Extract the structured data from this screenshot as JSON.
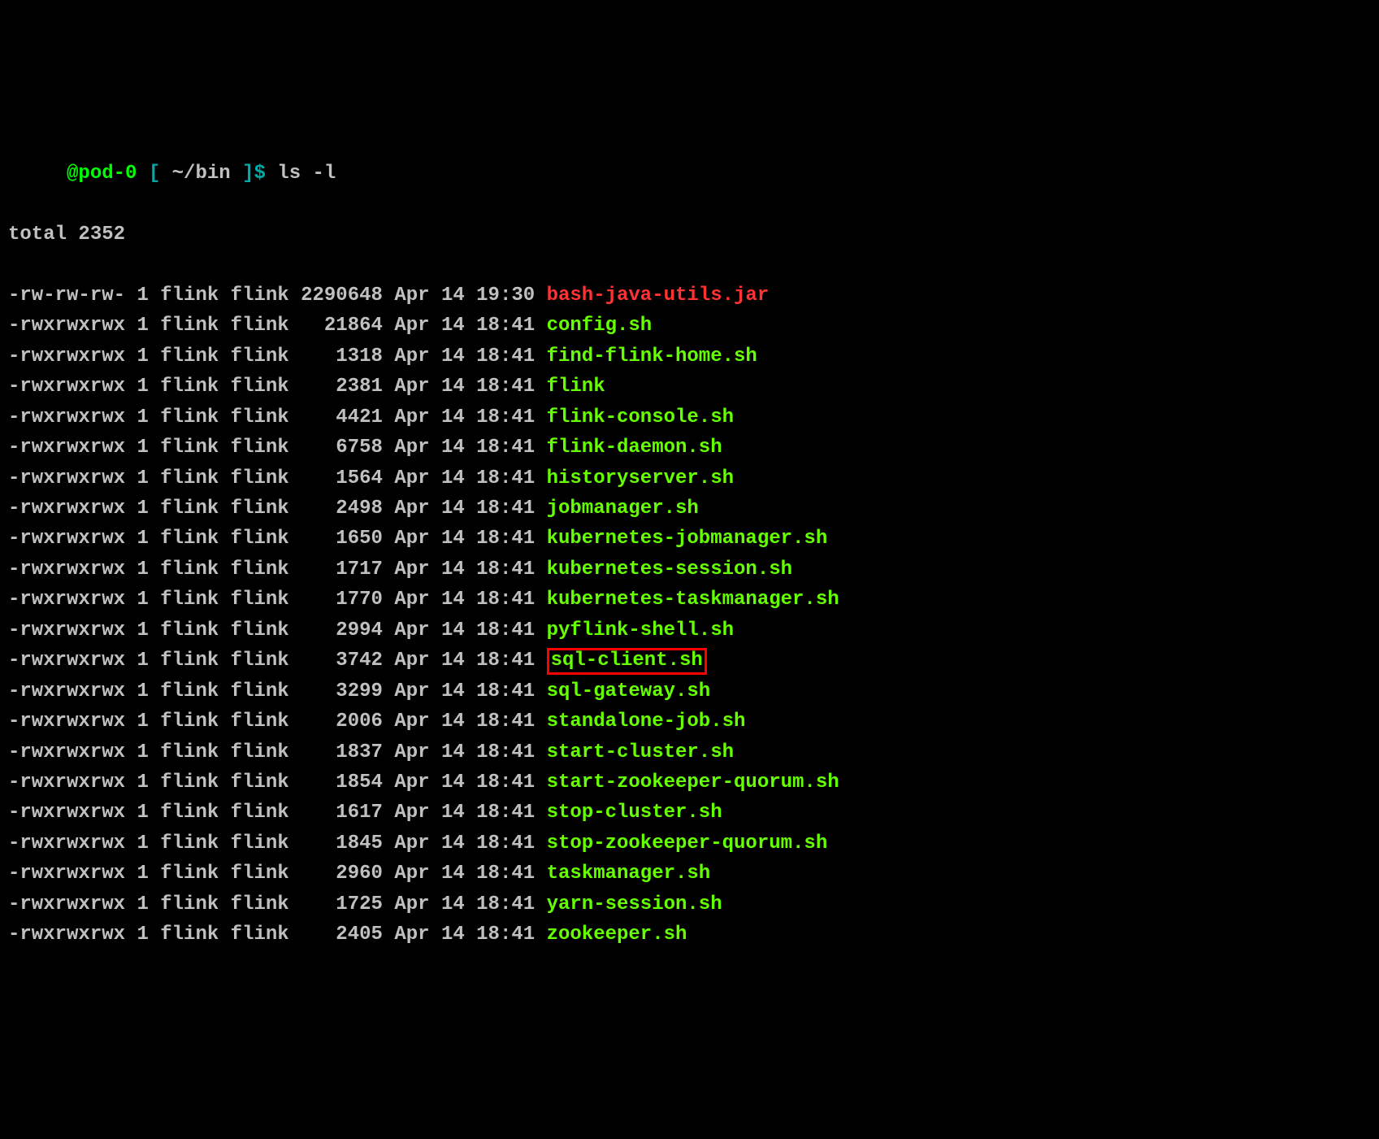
{
  "prompt": {
    "host": "@pod-0",
    "open_bracket": " [ ",
    "path": "~/bin",
    "close_bracket": " ]",
    "dollar": "$ ",
    "command": "ls -l"
  },
  "total_line": "total 2352",
  "files": [
    {
      "perms": "-rw-rw-rw-",
      "links": "1",
      "owner": "flink",
      "group": "flink",
      "size": "2290648",
      "month": "Apr",
      "day": "14",
      "time": "19:30",
      "name": "bash-java-utils.jar",
      "type": "regular",
      "highlighted": false
    },
    {
      "perms": "-rwxrwxrwx",
      "links": "1",
      "owner": "flink",
      "group": "flink",
      "size": "21864",
      "month": "Apr",
      "day": "14",
      "time": "18:41",
      "name": "config.sh",
      "type": "exec",
      "highlighted": false
    },
    {
      "perms": "-rwxrwxrwx",
      "links": "1",
      "owner": "flink",
      "group": "flink",
      "size": "1318",
      "month": "Apr",
      "day": "14",
      "time": "18:41",
      "name": "find-flink-home.sh",
      "type": "exec",
      "highlighted": false
    },
    {
      "perms": "-rwxrwxrwx",
      "links": "1",
      "owner": "flink",
      "group": "flink",
      "size": "2381",
      "month": "Apr",
      "day": "14",
      "time": "18:41",
      "name": "flink",
      "type": "exec",
      "highlighted": false
    },
    {
      "perms": "-rwxrwxrwx",
      "links": "1",
      "owner": "flink",
      "group": "flink",
      "size": "4421",
      "month": "Apr",
      "day": "14",
      "time": "18:41",
      "name": "flink-console.sh",
      "type": "exec",
      "highlighted": false
    },
    {
      "perms": "-rwxrwxrwx",
      "links": "1",
      "owner": "flink",
      "group": "flink",
      "size": "6758",
      "month": "Apr",
      "day": "14",
      "time": "18:41",
      "name": "flink-daemon.sh",
      "type": "exec",
      "highlighted": false
    },
    {
      "perms": "-rwxrwxrwx",
      "links": "1",
      "owner": "flink",
      "group": "flink",
      "size": "1564",
      "month": "Apr",
      "day": "14",
      "time": "18:41",
      "name": "historyserver.sh",
      "type": "exec",
      "highlighted": false
    },
    {
      "perms": "-rwxrwxrwx",
      "links": "1",
      "owner": "flink",
      "group": "flink",
      "size": "2498",
      "month": "Apr",
      "day": "14",
      "time": "18:41",
      "name": "jobmanager.sh",
      "type": "exec",
      "highlighted": false
    },
    {
      "perms": "-rwxrwxrwx",
      "links": "1",
      "owner": "flink",
      "group": "flink",
      "size": "1650",
      "month": "Apr",
      "day": "14",
      "time": "18:41",
      "name": "kubernetes-jobmanager.sh",
      "type": "exec",
      "highlighted": false
    },
    {
      "perms": "-rwxrwxrwx",
      "links": "1",
      "owner": "flink",
      "group": "flink",
      "size": "1717",
      "month": "Apr",
      "day": "14",
      "time": "18:41",
      "name": "kubernetes-session.sh",
      "type": "exec",
      "highlighted": false
    },
    {
      "perms": "-rwxrwxrwx",
      "links": "1",
      "owner": "flink",
      "group": "flink",
      "size": "1770",
      "month": "Apr",
      "day": "14",
      "time": "18:41",
      "name": "kubernetes-taskmanager.sh",
      "type": "exec",
      "highlighted": false
    },
    {
      "perms": "-rwxrwxrwx",
      "links": "1",
      "owner": "flink",
      "group": "flink",
      "size": "2994",
      "month": "Apr",
      "day": "14",
      "time": "18:41",
      "name": "pyflink-shell.sh",
      "type": "exec",
      "highlighted": false
    },
    {
      "perms": "-rwxrwxrwx",
      "links": "1",
      "owner": "flink",
      "group": "flink",
      "size": "3742",
      "month": "Apr",
      "day": "14",
      "time": "18:41",
      "name": "sql-client.sh",
      "type": "exec",
      "highlighted": true
    },
    {
      "perms": "-rwxrwxrwx",
      "links": "1",
      "owner": "flink",
      "group": "flink",
      "size": "3299",
      "month": "Apr",
      "day": "14",
      "time": "18:41",
      "name": "sql-gateway.sh",
      "type": "exec",
      "highlighted": false
    },
    {
      "perms": "-rwxrwxrwx",
      "links": "1",
      "owner": "flink",
      "group": "flink",
      "size": "2006",
      "month": "Apr",
      "day": "14",
      "time": "18:41",
      "name": "standalone-job.sh",
      "type": "exec",
      "highlighted": false
    },
    {
      "perms": "-rwxrwxrwx",
      "links": "1",
      "owner": "flink",
      "group": "flink",
      "size": "1837",
      "month": "Apr",
      "day": "14",
      "time": "18:41",
      "name": "start-cluster.sh",
      "type": "exec",
      "highlighted": false
    },
    {
      "perms": "-rwxrwxrwx",
      "links": "1",
      "owner": "flink",
      "group": "flink",
      "size": "1854",
      "month": "Apr",
      "day": "14",
      "time": "18:41",
      "name": "start-zookeeper-quorum.sh",
      "type": "exec",
      "highlighted": false
    },
    {
      "perms": "-rwxrwxrwx",
      "links": "1",
      "owner": "flink",
      "group": "flink",
      "size": "1617",
      "month": "Apr",
      "day": "14",
      "time": "18:41",
      "name": "stop-cluster.sh",
      "type": "exec",
      "highlighted": false
    },
    {
      "perms": "-rwxrwxrwx",
      "links": "1",
      "owner": "flink",
      "group": "flink",
      "size": "1845",
      "month": "Apr",
      "day": "14",
      "time": "18:41",
      "name": "stop-zookeeper-quorum.sh",
      "type": "exec",
      "highlighted": false
    },
    {
      "perms": "-rwxrwxrwx",
      "links": "1",
      "owner": "flink",
      "group": "flink",
      "size": "2960",
      "month": "Apr",
      "day": "14",
      "time": "18:41",
      "name": "taskmanager.sh",
      "type": "exec",
      "highlighted": false
    },
    {
      "perms": "-rwxrwxrwx",
      "links": "1",
      "owner": "flink",
      "group": "flink",
      "size": "1725",
      "month": "Apr",
      "day": "14",
      "time": "18:41",
      "name": "yarn-session.sh",
      "type": "exec",
      "highlighted": false
    },
    {
      "perms": "-rwxrwxrwx",
      "links": "1",
      "owner": "flink",
      "group": "flink",
      "size": "2405",
      "month": "Apr",
      "day": "14",
      "time": "18:41",
      "name": "zookeeper.sh",
      "type": "exec",
      "highlighted": false
    }
  ]
}
